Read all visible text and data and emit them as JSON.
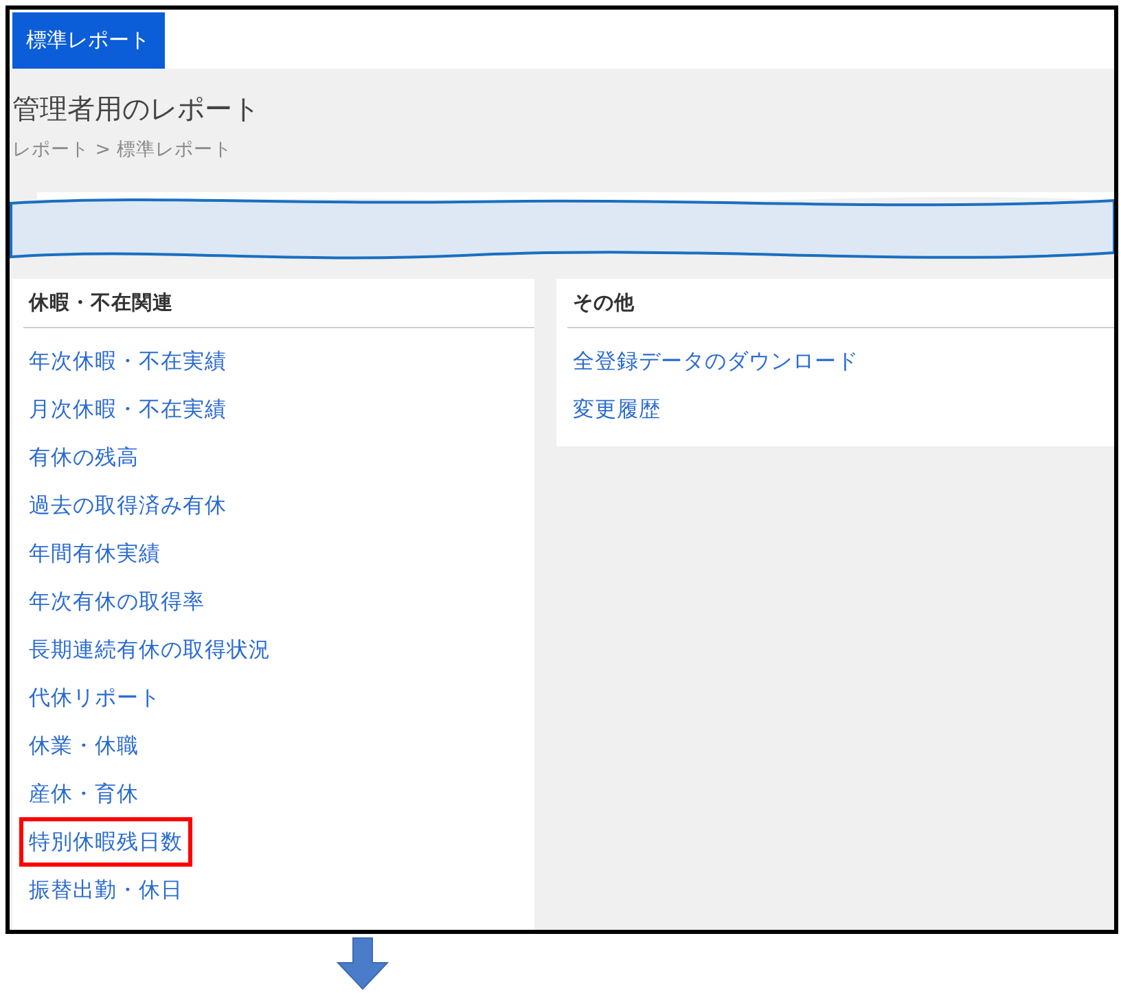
{
  "tab": {
    "label": "標準レポート",
    "selected": true
  },
  "page_title": "管理者用のレポート",
  "breadcrumb": "レポート > 標準レポート",
  "panels": [
    {
      "title": "休暇・不在関連",
      "links": [
        {
          "label": "年次休暇・不在実績",
          "highlighted": false
        },
        {
          "label": "月次休暇・不在実績",
          "highlighted": false
        },
        {
          "label": "有休の残高",
          "highlighted": false
        },
        {
          "label": "過去の取得済み有休",
          "highlighted": false
        },
        {
          "label": "年間有休実績",
          "highlighted": false
        },
        {
          "label": "年次有休の取得率",
          "highlighted": false
        },
        {
          "label": "長期連続有休の取得状況",
          "highlighted": false
        },
        {
          "label": "代休リポート",
          "highlighted": false
        },
        {
          "label": "休業・休職",
          "highlighted": false
        },
        {
          "label": "産休・育休",
          "highlighted": false
        },
        {
          "label": "特別休暇残日数",
          "highlighted": true
        },
        {
          "label": "振替出勤・休日",
          "highlighted": false
        }
      ]
    },
    {
      "title": "その他",
      "links": [
        {
          "label": "全登録データのダウンロード",
          "highlighted": false
        },
        {
          "label": "変更履歴",
          "highlighted": false
        }
      ]
    }
  ]
}
